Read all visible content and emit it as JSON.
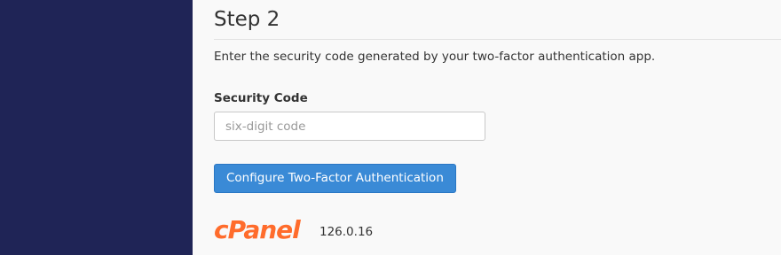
{
  "step": {
    "title": "Step 2",
    "instruction": "Enter the security code generated by your two-factor authentication app."
  },
  "form": {
    "security_code_label": "Security Code",
    "security_code_value": "",
    "security_code_placeholder": "six-digit code",
    "submit_label": "Configure Two-Factor Authentication"
  },
  "footer": {
    "logo_text": "cPanel",
    "version": "126.0.16"
  },
  "colors": {
    "sidebar": "#1f2456",
    "primary_button": "#3a8ad6",
    "brand_orange": "#ff6c2c"
  },
  "icons": {
    "logo": "cpanel-logo"
  }
}
